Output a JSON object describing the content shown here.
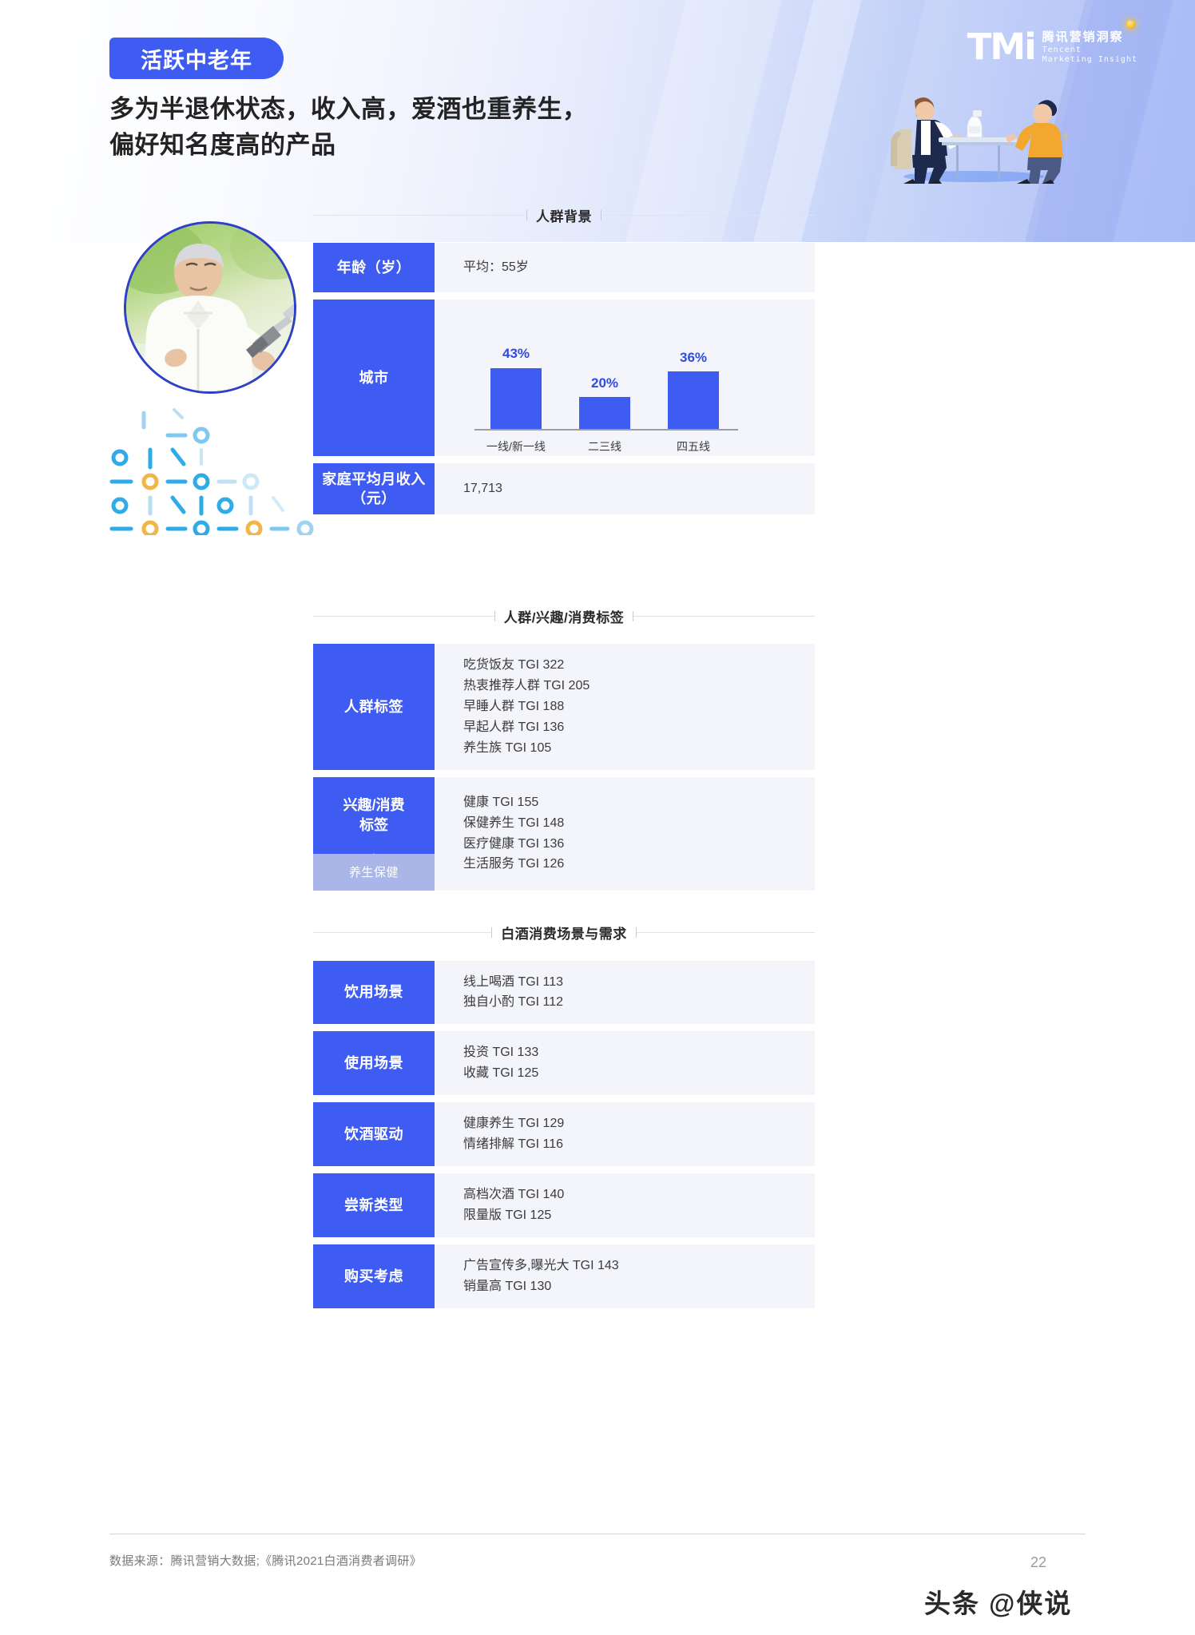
{
  "header": {
    "tag_label": "活跃中老年",
    "headline_line1": "多为半退休状态，收入高，爱酒也重养生，",
    "headline_line2": "偏好知名度高的产品",
    "logo_mark": "TMi",
    "logo_cn": "腾讯营销洞察",
    "logo_en_line1": "Tencent",
    "logo_en_line2": "Marketing Insight",
    "accent_color": "#3E5BF2"
  },
  "sections": [
    {
      "title": "人群背景"
    },
    {
      "title": "人群/兴趣/消费标签"
    },
    {
      "title": "白酒消费场景与需求"
    }
  ],
  "background_rows": {
    "age": {
      "label": "年龄（岁）",
      "value": "平均：55岁"
    },
    "city": {
      "label": "城市"
    },
    "income": {
      "label": "家庭平均月收入\n（元）",
      "label_line1": "家庭平均月收入",
      "label_line2": "（元）",
      "value": "17,713"
    }
  },
  "chart_data": {
    "type": "bar",
    "title": "城市",
    "categories": [
      "一线/新一线",
      "二三线",
      "四五线"
    ],
    "values": [
      43,
      20,
      36
    ],
    "value_labels": [
      "43%",
      "20%",
      "36%"
    ],
    "xlabel": "",
    "ylabel": "",
    "ylim": [
      0,
      50
    ],
    "grid": false,
    "legend": "none",
    "series_color": "#3E5BF2"
  },
  "tag_rows": [
    {
      "label": "人群标签",
      "sub_label": null,
      "items": [
        "吃货饭友 TGI 322",
        "热衷推荐人群 TGI 205",
        "早睡人群 TGI 188",
        "早起人群 TGI 136",
        "养生族 TGI 105"
      ]
    },
    {
      "label_line1": "兴趣/消费",
      "label_line2": "标签",
      "sub_label": "养生保健",
      "items": [
        "健康 TGI 155",
        "保健养生 TGI 148",
        "医疗健康 TGI 136",
        "生活服务 TGI 126"
      ]
    }
  ],
  "scenario_rows": [
    {
      "label": "饮用场景",
      "items": [
        "线上喝酒 TGI 113",
        "独自小酌 TGI 112"
      ]
    },
    {
      "label": "使用场景",
      "items": [
        "投资 TGI 133",
        "收藏 TGI 125"
      ]
    },
    {
      "label": "饮酒驱动",
      "items": [
        "健康养生 TGI 129",
        "情绪排解 TGI 116"
      ]
    },
    {
      "label": "尝新类型",
      "items": [
        "高档次酒 TGI 140",
        "限量版 TGI 125"
      ]
    },
    {
      "label": "购买考虑",
      "items": [
        "广告宣传多,曝光大 TGI 143",
        "销量高 TGI 130"
      ]
    }
  ],
  "footer": {
    "source": "数据来源：腾讯营销大数据;《腾讯2021白酒消费者调研》",
    "page_number": "22",
    "watermark": "头条 @侠说"
  }
}
